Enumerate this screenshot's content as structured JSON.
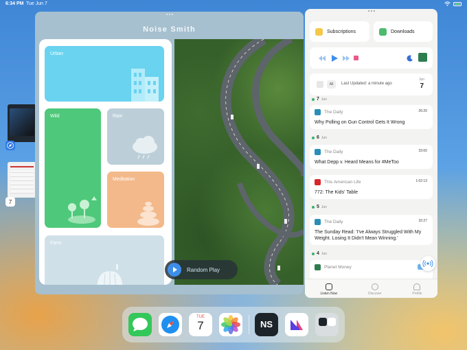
{
  "status_bar": {
    "time": "6:34 PM",
    "date": "Tue Jun 7"
  },
  "noise_app": {
    "title": "Noise Smith",
    "tiles": [
      "Urban",
      "Wild",
      "Rain",
      "Meditation",
      "Farm"
    ],
    "random_play_label": "Random Play"
  },
  "podcast_app": {
    "subscriptions_label": "Subscriptions",
    "downloads_label": "Downloads",
    "filter_label": "All",
    "last_updated": "Last Updated: a minute ago",
    "calendar_month": "Jun",
    "calendar_day": "7",
    "groups": [
      {
        "day": "7",
        "month": "Jun",
        "episodes": [
          {
            "show": "The Daily",
            "duration": "26:20",
            "title": "Why Polling on Gun Control Gets It Wrong"
          }
        ]
      },
      {
        "day": "6",
        "month": "Jun",
        "episodes": [
          {
            "show": "The Daily",
            "duration": "33:00",
            "title": "What Depp v. Heard Means for #MeToo"
          },
          {
            "show": "This American Life",
            "duration": "1:02:13",
            "title": "772: The Kids' Table"
          }
        ]
      },
      {
        "day": "5",
        "month": "Jun",
        "episodes": [
          {
            "show": "The Daily",
            "duration": "32:27",
            "title": "The Sunday Read: 'I've Always Struggled With My Weight. Losing It Didn't Mean Winning.'"
          }
        ]
      },
      {
        "day": "4",
        "month": "Jun",
        "episodes": [
          {
            "show": "Planet Money",
            "duration": "",
            "title": ""
          }
        ]
      }
    ],
    "tabs": [
      "Listen Now",
      "Discover",
      "Profile"
    ]
  },
  "dock": {
    "calendar_month": "TUE",
    "calendar_day": "7",
    "ns_label": "NS",
    "stage_badge_day": "7"
  },
  "colors": {
    "accent_blue": "#3d8eea",
    "green": "#37b26c",
    "urban": "#69d3f0",
    "wild": "#4ec87a",
    "rain": "#bccfd9",
    "meditation": "#f3b98a",
    "farm": "#cfe0e8"
  }
}
